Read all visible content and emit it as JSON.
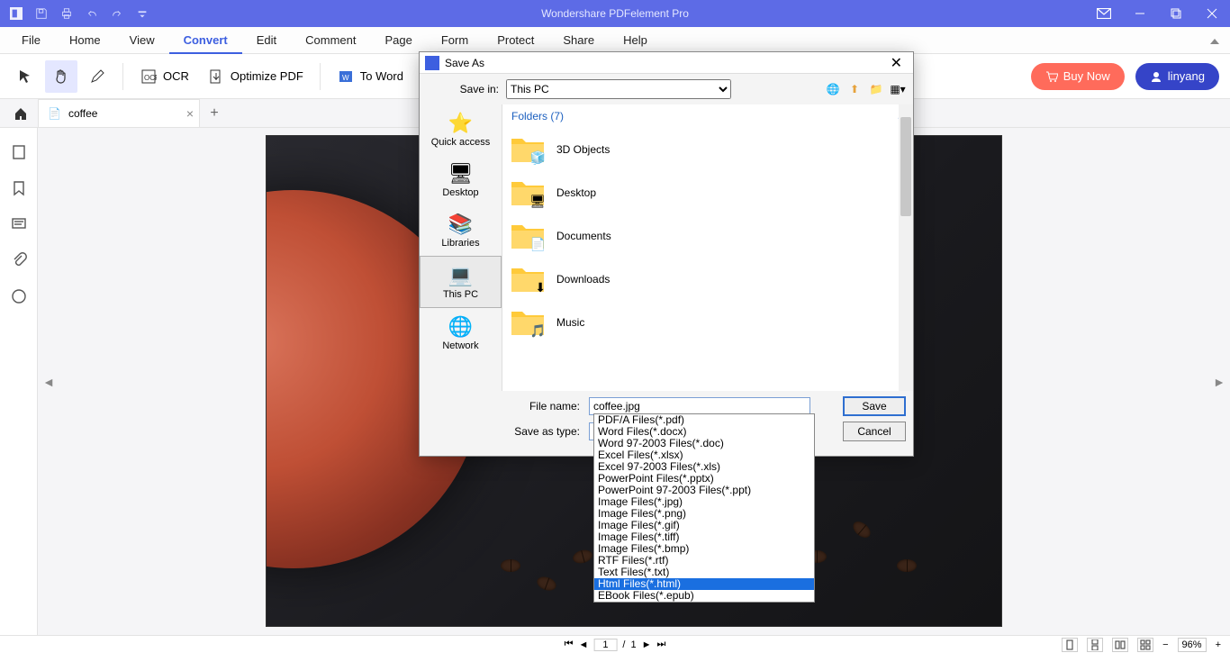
{
  "app": {
    "title": "Wondershare PDFelement Pro"
  },
  "menu": {
    "items": [
      "File",
      "Home",
      "View",
      "Convert",
      "Edit",
      "Comment",
      "Page",
      "Form",
      "Protect",
      "Share",
      "Help"
    ],
    "active": 3
  },
  "toolbar": {
    "ocr": "OCR",
    "optimize": "Optimize PDF",
    "toword": "To Word",
    "buy": "Buy Now",
    "user": "linyang"
  },
  "tabs": {
    "items": [
      {
        "label": "coffee"
      }
    ]
  },
  "dialog": {
    "title": "Save As",
    "savein_label": "Save in:",
    "savein_value": "This PC",
    "places": [
      "Quick access",
      "Desktop",
      "Libraries",
      "This PC",
      "Network"
    ],
    "places_selected": 3,
    "folder_header": "Folders (7)",
    "folders": [
      "3D Objects",
      "Desktop",
      "Documents",
      "Downloads",
      "Music"
    ],
    "filename_label": "File name:",
    "filename_value": "coffee.jpg",
    "saveastype_label": "Save as type:",
    "saveastype_value": "Image Files(*.jpg)",
    "save_btn": "Save",
    "cancel_btn": "Cancel",
    "type_options": [
      "PDF/A Files(*.pdf)",
      "Word Files(*.docx)",
      "Word 97-2003 Files(*.doc)",
      "Excel Files(*.xlsx)",
      "Excel 97-2003 Files(*.xls)",
      "PowerPoint Files(*.pptx)",
      "PowerPoint 97-2003 Files(*.ppt)",
      "Image Files(*.jpg)",
      "Image Files(*.png)",
      "Image Files(*.gif)",
      "Image Files(*.tiff)",
      "Image Files(*.bmp)",
      "RTF Files(*.rtf)",
      "Text Files(*.txt)",
      "Html Files(*.html)",
      "EBook Files(*.epub)"
    ],
    "type_selected": 14
  },
  "status": {
    "page_current": "1",
    "page_total": "1",
    "zoom": "96%"
  }
}
